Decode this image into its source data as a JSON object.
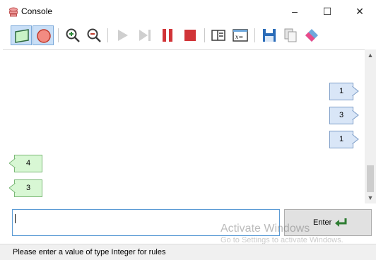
{
  "window": {
    "title": "Console"
  },
  "title_buttons": {
    "minimize": "–",
    "maximize": "☐",
    "close": "✕"
  },
  "toolbar": {
    "icons": [
      "io-shape-icon",
      "stop-circle-icon",
      "zoom-in-icon",
      "zoom-out-icon",
      "play-icon",
      "step-icon",
      "pause-icon",
      "stop-icon",
      "variables-panel-icon",
      "expression-icon",
      "save-icon",
      "copy-icon",
      "eraser-icon"
    ],
    "pressed": [
      "io-shape-icon",
      "stop-circle-icon"
    ]
  },
  "console": {
    "outputs": [
      "1",
      "3",
      "1"
    ],
    "inputs": [
      "4",
      "3"
    ]
  },
  "input": {
    "value": ""
  },
  "enter": {
    "label": "Enter"
  },
  "watermark": {
    "line1": "Activate Windows",
    "line2": "Go to Settings to activate Windows."
  },
  "status": {
    "text": "Please enter a value of type Integer for rules"
  },
  "colors": {
    "output_bubble": "#d9e6f7",
    "input_bubble": "#d8f7d4",
    "accent": "#5b9bd5",
    "pause_red": "#d13438"
  }
}
